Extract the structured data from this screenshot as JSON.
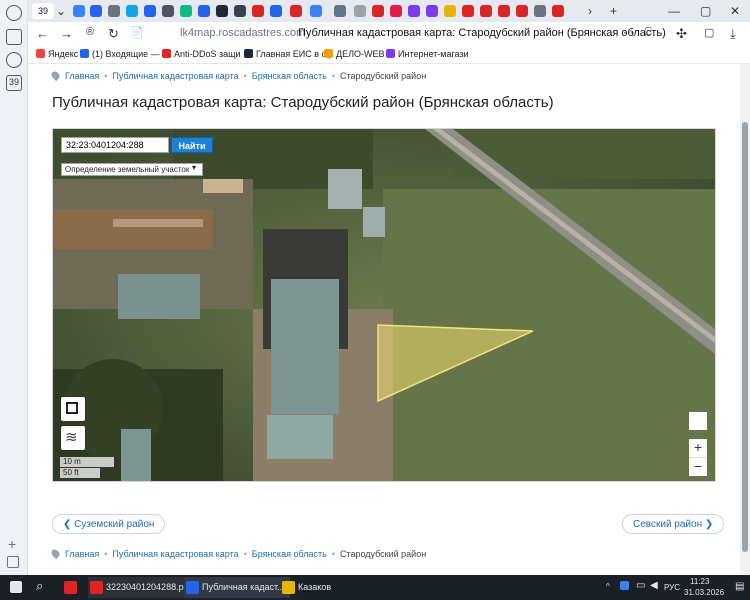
{
  "browser": {
    "tab_count": "39",
    "url_host": "lk4map.roscadastres.com",
    "url_title": "Публичная кадастровая карта: Стародубский район (Брянская область)",
    "bookmarks": [
      {
        "label": "Яндекс",
        "color": "#ef4444"
      },
      {
        "label": "(1) Входящие — F",
        "color": "#2563eb"
      },
      {
        "label": "Anti-DDoS защи",
        "color": "#dc2626"
      },
      {
        "label": "Главная ЕИС в сф",
        "color": "#1f2937"
      },
      {
        "label": "ДЕЛО-WEB",
        "color": "#f59e0b"
      },
      {
        "label": "Интернет-магази",
        "color": "#7c3aed"
      }
    ]
  },
  "page": {
    "breadcrumbs": [
      "Главная",
      "Публичная кадастровая карта",
      "Брянская область",
      "Стародубский район"
    ],
    "title": "Публичная кадастровая карта: Стародубский район (Брянская область)",
    "map": {
      "search_value": "32:23:0401204:288",
      "search_button": "Найти",
      "definition_select": "Определение  земельный участок",
      "scale_m": "10 m",
      "scale_ft": "50 ft",
      "zoom_in": "+",
      "zoom_out": "−",
      "parcel_color": "#f1e06b"
    },
    "prev_link": "Суземский район",
    "next_link": "Севский район"
  },
  "taskbar": {
    "items": [
      {
        "label": "32230401204288.pd...",
        "color": "#dc2626"
      },
      {
        "label": "Публичная кадаст...",
        "color": "#2563eb"
      },
      {
        "label": "Казаков",
        "color": "#eab308"
      }
    ],
    "lang": "РУС",
    "time": "11:23",
    "date": "31.03.2026"
  }
}
